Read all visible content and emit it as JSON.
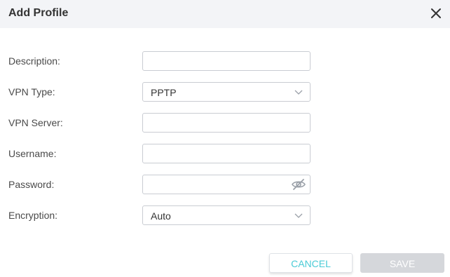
{
  "dialog": {
    "title": "Add Profile"
  },
  "fields": {
    "description": {
      "label": "Description:",
      "value": ""
    },
    "vpn_type": {
      "label": "VPN Type:",
      "value": "PPTP"
    },
    "vpn_server": {
      "label": "VPN Server:",
      "value": ""
    },
    "username": {
      "label": "Username:",
      "value": ""
    },
    "password": {
      "label": "Password:",
      "value": ""
    },
    "encryption": {
      "label": "Encryption:",
      "value": "Auto"
    }
  },
  "buttons": {
    "cancel_label": "CANCEL",
    "save_label": "SAVE"
  },
  "icons": {
    "close": "close-icon",
    "dropdown": "chevron-down-icon",
    "password_toggle": "eye-slash-icon"
  },
  "colors": {
    "header_bg": "#f3f4f7",
    "accent": "#4acbd6",
    "save_disabled_bg": "#d5d7db",
    "field_border": "#c9ccd2"
  }
}
